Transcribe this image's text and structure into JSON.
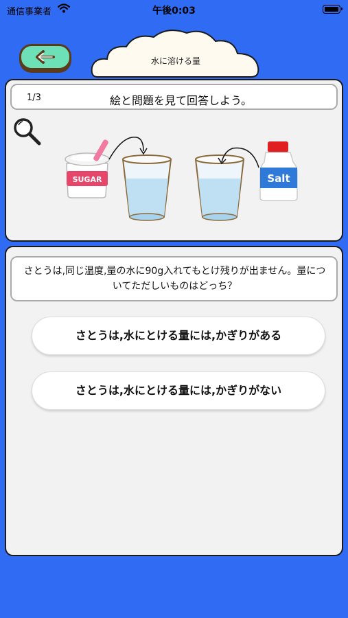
{
  "status_bar": {
    "carrier": "通信事業者",
    "time": "午後0:03"
  },
  "header": {
    "title": "水に溶ける量",
    "back_icon": "left-arrow-icon"
  },
  "quiz": {
    "progress": "1/3",
    "instruction": "絵と問題を見て回答しよう。",
    "illustration": {
      "sugar_label": "SUGAR",
      "salt_label": "Salt"
    },
    "question": "さとうは,同じ温度,量の水に90g入れてもとけ残りが出ません。量についてただしいものはどっち？",
    "answers": [
      "さとうは,水にとける量には,かぎりがある",
      "さとうは,水にとける量には,かぎりがない"
    ]
  },
  "colors": {
    "background": "#2f6cf3",
    "back_button": "#6ee0b8",
    "panel": "#f2f2f2"
  }
}
